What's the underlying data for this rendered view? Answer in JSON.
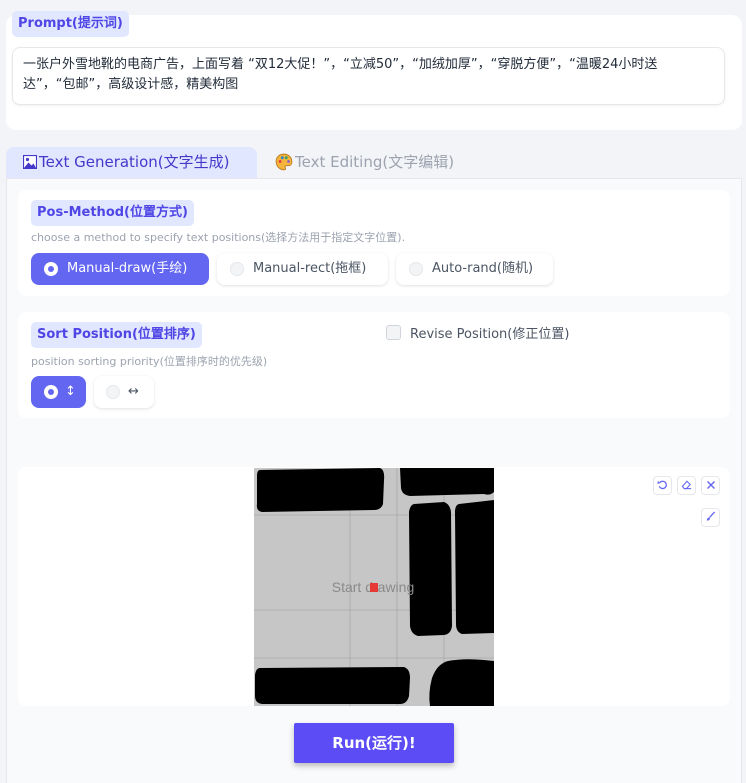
{
  "prompt": {
    "label": "Prompt(提示词)",
    "value_line1": "一张户外雪地靴的电商广告，上面写着 “双12大促！”，“立减50”，“加绒加厚”，“穿脱方便”，“温暖24小时送",
    "value_line2": "达”，“包邮”，高级设计感，精美构图"
  },
  "tabs": [
    {
      "label": "Text Generation(文字生成)",
      "icon": "image-icon",
      "active": true
    },
    {
      "label": "Text Editing(文字编辑)",
      "icon": "palette-icon",
      "active": false
    }
  ],
  "pos_method": {
    "label": "Pos-Method(位置方式)",
    "hint": "choose a method to specify text positions(选择方法用于指定文字位置).",
    "options": [
      "Manual-draw(手绘)",
      "Manual-rect(拖框)",
      "Auto-rand(随机)"
    ],
    "selected": "Manual-draw(手绘)"
  },
  "sort_position": {
    "label": "Sort Position(位置排序)",
    "hint": "position sorting priority(位置排序时的优先级)",
    "options": [
      "↕",
      "↔"
    ],
    "selected": "↕"
  },
  "revise": {
    "label": "Revise Position(修正位置)",
    "checked": false
  },
  "sketchpad": {
    "placeholder": "Start drawing",
    "controls": [
      "undo-icon",
      "eraser-icon",
      "close-icon",
      "brush-icon"
    ]
  },
  "run_button": {
    "label": "Run(运行)!"
  },
  "colors": {
    "accent": "#6366f1",
    "accent_light": "#e0e7ff",
    "run": "#5b4cf5"
  }
}
